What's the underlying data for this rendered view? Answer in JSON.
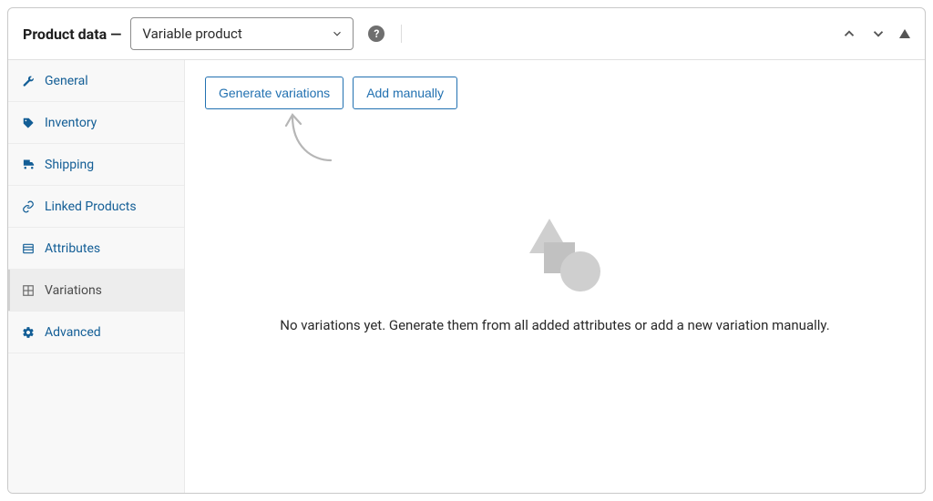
{
  "header": {
    "title": "Product data —",
    "product_type": "Variable product",
    "help_glyph": "?"
  },
  "sidebar": {
    "items": [
      {
        "label": "General",
        "icon": "wrench-icon",
        "active": false
      },
      {
        "label": "Inventory",
        "icon": "tag-icon",
        "active": false
      },
      {
        "label": "Shipping",
        "icon": "truck-icon",
        "active": false
      },
      {
        "label": "Linked Products",
        "icon": "link-icon",
        "active": false
      },
      {
        "label": "Attributes",
        "icon": "list-icon",
        "active": false
      },
      {
        "label": "Variations",
        "icon": "grid-icon",
        "active": true
      },
      {
        "label": "Advanced",
        "icon": "gear-icon",
        "active": false
      }
    ]
  },
  "actions": {
    "generate": "Generate variations",
    "add_manual": "Add manually"
  },
  "empty_state": {
    "message": "No variations yet. Generate them from all added attributes or add a new variation manually."
  }
}
